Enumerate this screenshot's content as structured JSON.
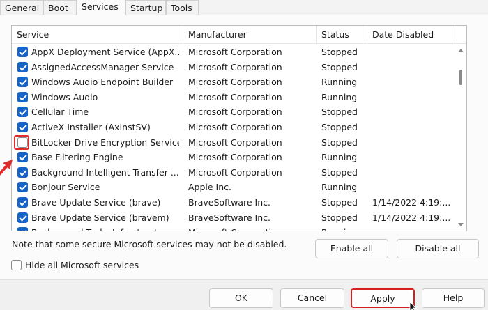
{
  "tabs": [
    {
      "label": "General"
    },
    {
      "label": "Boot"
    },
    {
      "label": "Services",
      "active": true
    },
    {
      "label": "Startup"
    },
    {
      "label": "Tools"
    }
  ],
  "table": {
    "columns": [
      "Service",
      "Manufacturer",
      "Status",
      "Date Disabled"
    ],
    "rows": [
      {
        "checked": true,
        "service": "AppX Deployment Service (AppX...",
        "manufacturer": "Microsoft Corporation",
        "status": "Stopped",
        "date": ""
      },
      {
        "checked": true,
        "service": "AssignedAccessManager Service",
        "manufacturer": "Microsoft Corporation",
        "status": "Stopped",
        "date": ""
      },
      {
        "checked": true,
        "service": "Windows Audio Endpoint Builder",
        "manufacturer": "Microsoft Corporation",
        "status": "Running",
        "date": ""
      },
      {
        "checked": true,
        "service": "Windows Audio",
        "manufacturer": "Microsoft Corporation",
        "status": "Running",
        "date": ""
      },
      {
        "checked": true,
        "service": "Cellular Time",
        "manufacturer": "Microsoft Corporation",
        "status": "Stopped",
        "date": ""
      },
      {
        "checked": true,
        "service": "ActiveX Installer (AxInstSV)",
        "manufacturer": "Microsoft Corporation",
        "status": "Stopped",
        "date": ""
      },
      {
        "checked": false,
        "service": "BitLocker Drive Encryption Service",
        "manufacturer": "Microsoft Corporation",
        "status": "Stopped",
        "date": ""
      },
      {
        "checked": true,
        "service": "Base Filtering Engine",
        "manufacturer": "Microsoft Corporation",
        "status": "Running",
        "date": ""
      },
      {
        "checked": true,
        "service": "Background Intelligent Transfer ...",
        "manufacturer": "Microsoft Corporation",
        "status": "Stopped",
        "date": ""
      },
      {
        "checked": true,
        "service": "Bonjour Service",
        "manufacturer": "Apple Inc.",
        "status": "Running",
        "date": ""
      },
      {
        "checked": true,
        "service": "Brave Update Service (brave)",
        "manufacturer": "BraveSoftware Inc.",
        "status": "Stopped",
        "date": "1/14/2022 4:19:..."
      },
      {
        "checked": true,
        "service": "Brave Update Service (bravem)",
        "manufacturer": "BraveSoftware Inc.",
        "status": "Stopped",
        "date": "1/14/2022 4:19:..."
      },
      {
        "checked": true,
        "service": "Background Tasks Infrastructure ...",
        "manufacturer": "Microsoft Corporation",
        "status": "Running",
        "date": ""
      }
    ]
  },
  "note": "Note that some secure Microsoft services may not be disabled.",
  "buttons": {
    "enable_all": "Enable all",
    "disable_all": "Disable all",
    "ok": "OK",
    "cancel": "Cancel",
    "apply": "Apply",
    "help": "Help"
  },
  "hide_ms": {
    "label": "Hide all Microsoft services",
    "checked": false
  },
  "colors": {
    "checkbox_accent": "#1764c8",
    "highlight": "#e02b2b"
  }
}
